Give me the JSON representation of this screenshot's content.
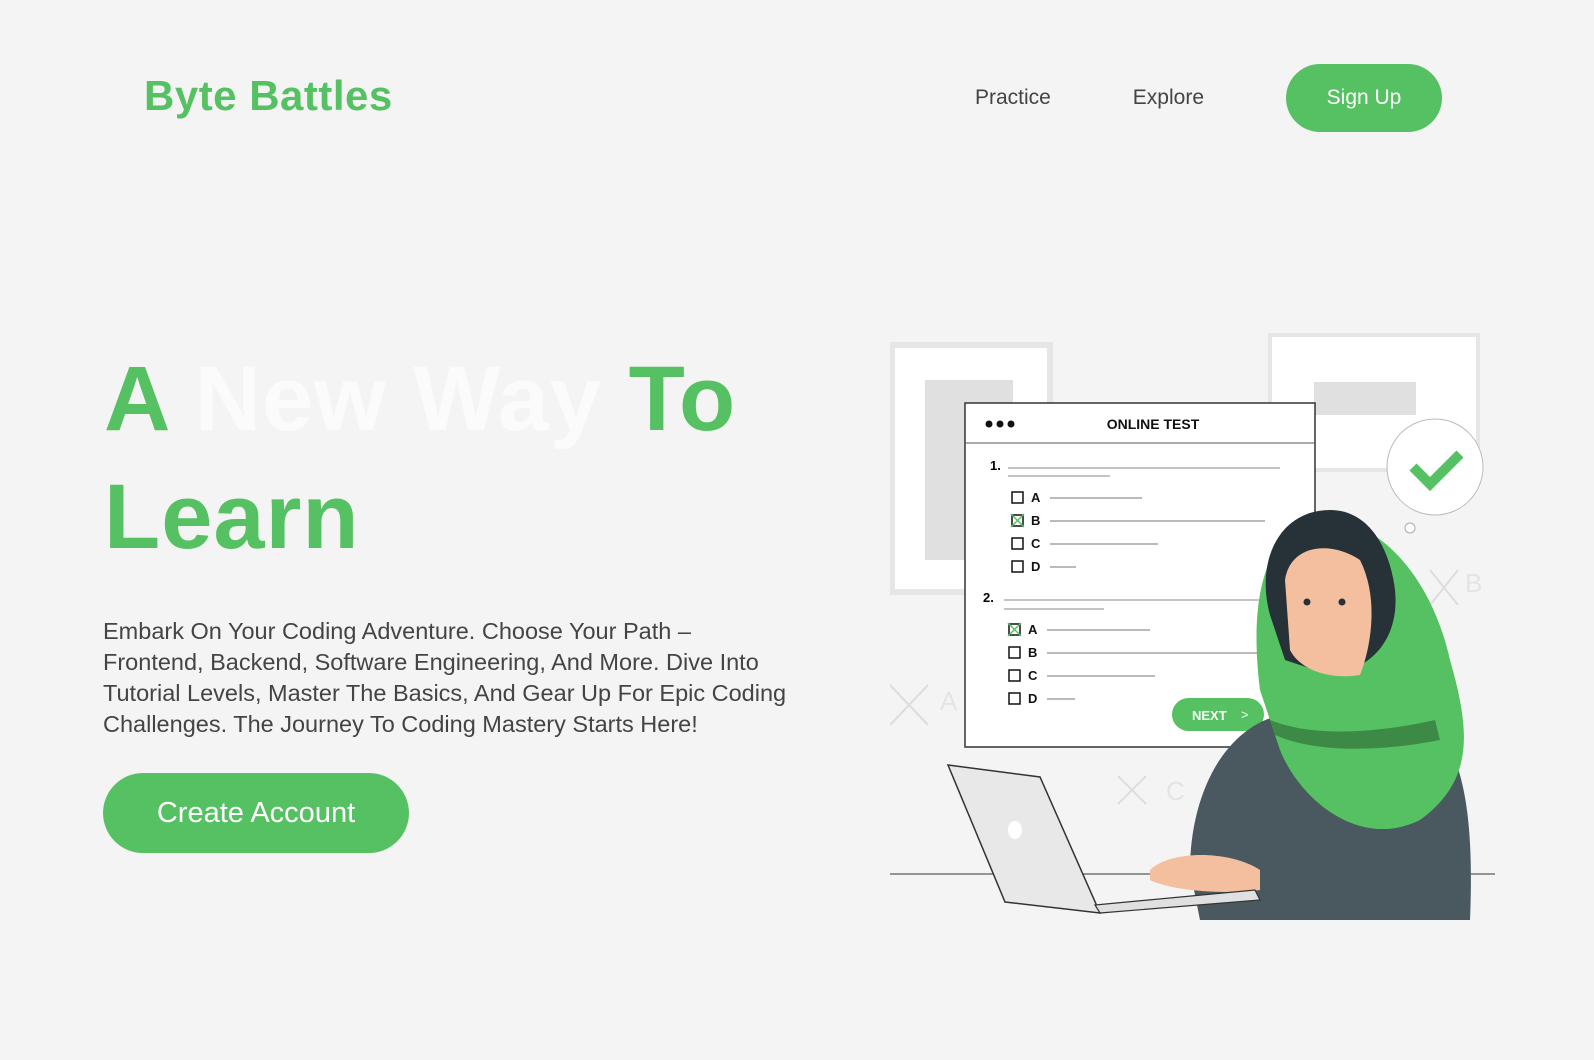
{
  "header": {
    "logo": "Byte Battles",
    "nav": [
      {
        "label": "Practice"
      },
      {
        "label": "Explore"
      }
    ],
    "signup_label": "Sign Up"
  },
  "hero": {
    "title_part1": "A",
    "title_part2": "New Way",
    "title_part3": "To",
    "title_line2": "Learn",
    "description": "Embark On Your Coding Adventure. Choose Your Path – Frontend, Backend, Software Engineering, And More. Dive Into Tutorial Levels, Master The Basics, And Gear Up For Epic Coding Challenges. The Journey To Coding Mastery Starts Here!",
    "cta_label": "Create Account"
  },
  "illustration": {
    "window_title": "ONLINE TEST",
    "q1": "1.",
    "q2": "2.",
    "options": [
      "A",
      "B",
      "C",
      "D"
    ],
    "next_label": "NEXT",
    "next_arrow": ">",
    "faded_letters": [
      "A",
      "B",
      "C"
    ]
  },
  "colors": {
    "accent": "#56c162",
    "background": "#f4f4f4",
    "text": "#444444"
  }
}
